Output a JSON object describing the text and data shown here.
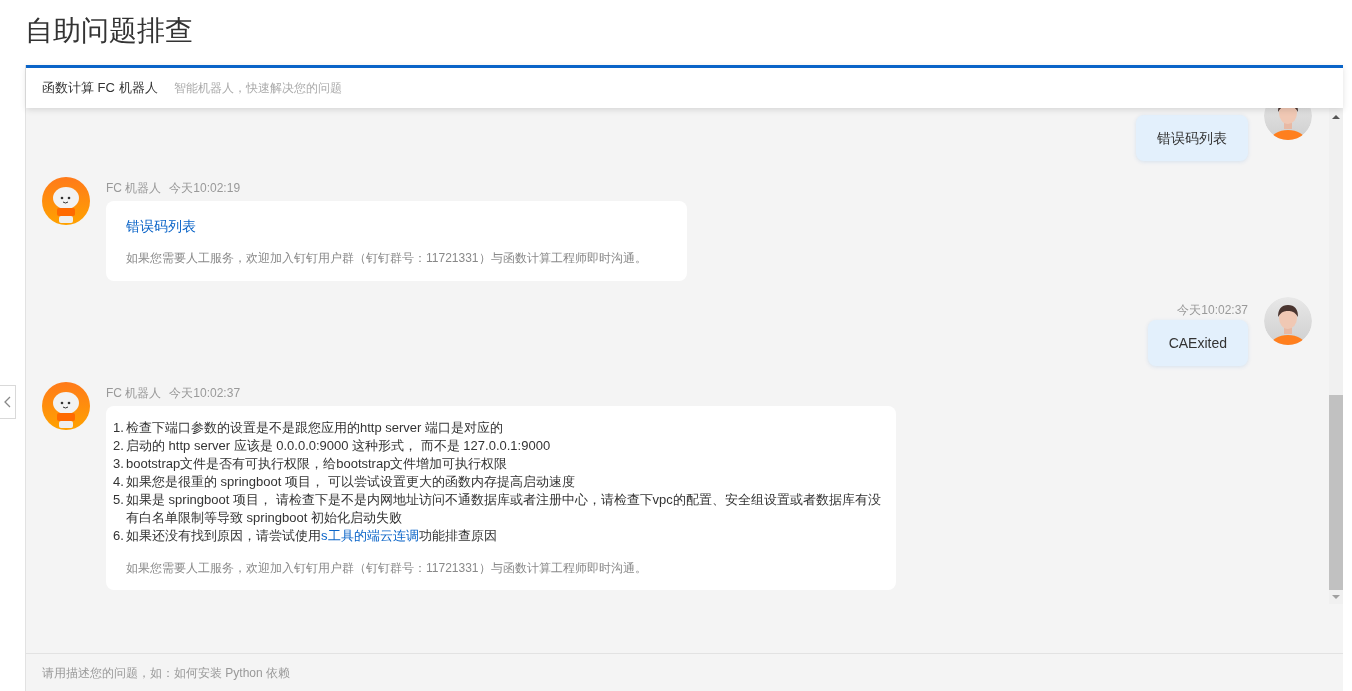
{
  "page_title": "自助问题排查",
  "chat_header": {
    "title": "函数计算 FC 机器人",
    "subtitle": "智能机器人，快速解决您的问题"
  },
  "messages": [
    {
      "kind": "user",
      "text": "错误码列表"
    },
    {
      "kind": "bot",
      "name": "FC 机器人",
      "time": "今天10:02:19",
      "link": "错误码列表",
      "footer": "如果您需要人工服务，欢迎加入钉钉用户群（钉钉群号：11721331）与函数计算工程师即时沟通。"
    },
    {
      "kind": "user",
      "time": "今天10:02:37",
      "text": "CAExited"
    },
    {
      "kind": "bot",
      "name": "FC 机器人",
      "time": "今天10:02:37",
      "items": [
        {
          "number": "1.",
          "text": "检查下端口参数的设置是不是跟您应用的http server 端口是对应的"
        },
        {
          "number": "2.",
          "text": "启动的 http server 应该是 0.0.0.0:9000 这种形式， 而不是 127.0.0.1:9000"
        },
        {
          "number": "3.",
          "text": "bootstrap文件是否有可执行权限，给bootstrap文件增加可执行权限"
        },
        {
          "number": "4.",
          "text": "如果您是很重的 springboot 项目， 可以尝试设置更大的函数内存提高启动速度"
        },
        {
          "number": "5.",
          "text": "如果是 springboot 项目， 请检查下是不是内网地址访问不通数据库或者注册中心，请检查下vpc的配置、安全组设置或者数据库有没有白名单限制等导致 springboot 初始化启动失败"
        },
        {
          "number": "6.",
          "text": "如果还没有找到原因，请尝试使用",
          "link": "s工具的端云连调",
          "text_after": "功能排查原因"
        }
      ],
      "footer": "如果您需要人工服务，欢迎加入钉钉用户群（钉钉群号：11721331）与函数计算工程师即时沟通。"
    }
  ],
  "input": {
    "placeholder": "请用描述您的问题，如：如何安装 Python 依赖"
  }
}
